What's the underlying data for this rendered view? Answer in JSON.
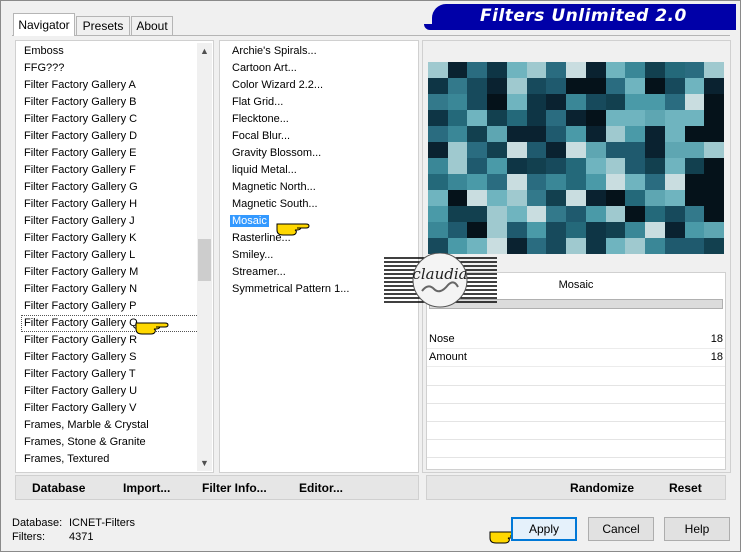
{
  "window": {
    "logo_text": "Filters Unlimited 2.0",
    "tabs": [
      {
        "label": "Navigator",
        "active": true
      },
      {
        "label": "Presets",
        "active": false
      },
      {
        "label": "About",
        "active": false
      }
    ]
  },
  "categories": {
    "items": [
      "Emboss",
      "FFG???",
      "Filter Factory Gallery A",
      "Filter Factory Gallery B",
      "Filter Factory Gallery C",
      "Filter Factory Gallery D",
      "Filter Factory Gallery E",
      "Filter Factory Gallery F",
      "Filter Factory Gallery G",
      "Filter Factory Gallery H",
      "Filter Factory Gallery J",
      "Filter Factory Gallery K",
      "Filter Factory Gallery L",
      "Filter Factory Gallery M",
      "Filter Factory Gallery N",
      "Filter Factory Gallery P",
      "Filter Factory Gallery Q",
      "Filter Factory Gallery R",
      "Filter Factory Gallery S",
      "Filter Factory Gallery T",
      "Filter Factory Gallery U",
      "Filter Factory Gallery V",
      "Frames, Marble & Crystal",
      "Frames, Stone & Granite",
      "Frames, Textured"
    ],
    "selected_index": 16,
    "scroll_up": "▲",
    "scroll_down": "▼"
  },
  "filters": {
    "items": [
      "Archie's Spirals...",
      "Cartoon Art...",
      "Color Wizard 2.2...",
      "Flat Grid...",
      "Flecktone...",
      "Focal Blur...",
      "Gravity Blossom...",
      "liquid Metal...",
      "Magnetic North...",
      "Magnetic South...",
      "Mosaic",
      "Rasterline...",
      "Smiley...",
      "Streamer...",
      "Symmetrical Pattern 1..."
    ],
    "selected_index": 10
  },
  "left_buttons": {
    "database": "Database",
    "import": "Import...",
    "filter_info": "Filter Info...",
    "editor": "Editor..."
  },
  "right_buttons": {
    "randomize": "Randomize",
    "reset": "Reset"
  },
  "settings": {
    "filter_name": "Mosaic",
    "params": [
      {
        "label": "Nose",
        "value": "18"
      },
      {
        "label": "Amount",
        "value": "18"
      }
    ]
  },
  "watermark": {
    "text": "claudia"
  },
  "status": {
    "database_label": "Database:",
    "database_value": "ICNET-Filters",
    "filters_label": "Filters:",
    "filters_value": "4371"
  },
  "dialog_buttons": {
    "apply": "Apply",
    "cancel": "Cancel",
    "help": "Help"
  },
  "colors": {
    "logo_blue": "#0000a8",
    "selection_blue": "#3399ff",
    "pointer_yellow": "#ffd800"
  }
}
